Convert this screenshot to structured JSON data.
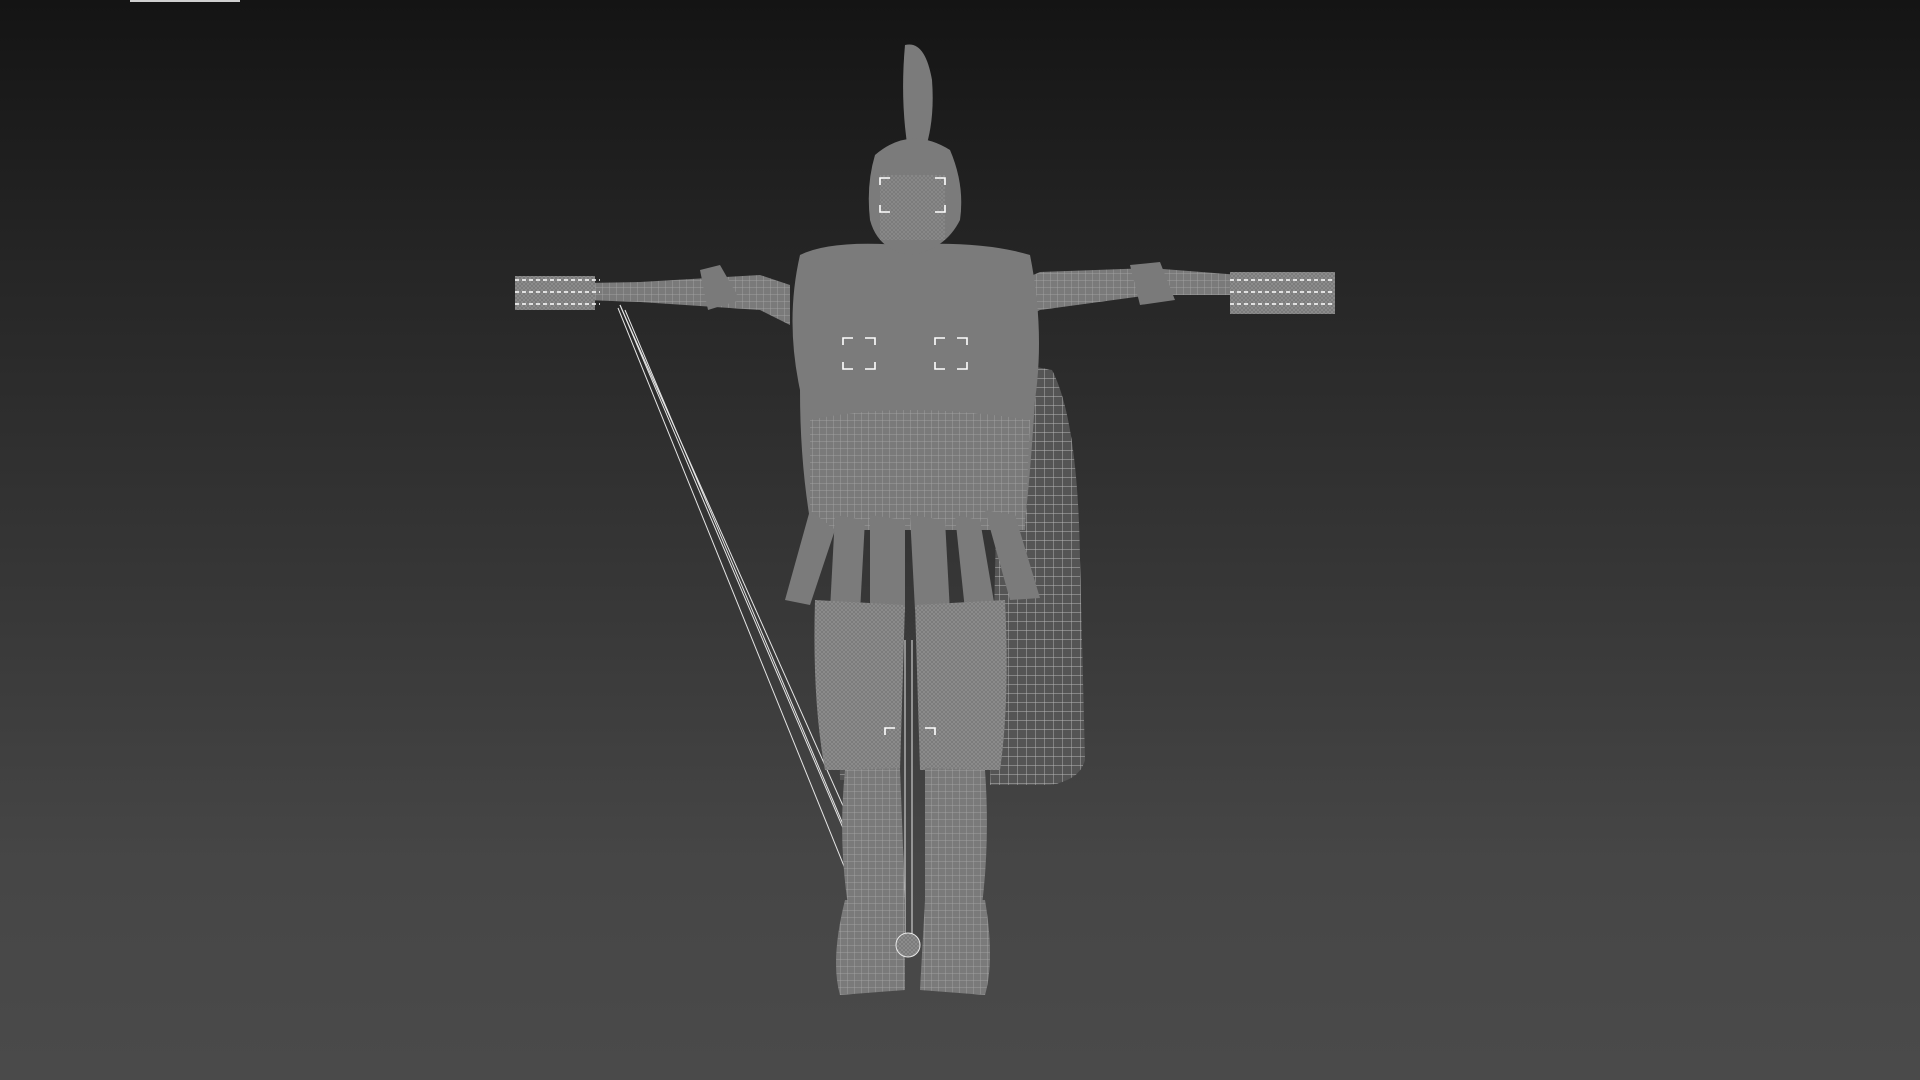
{
  "app": {
    "kind": "3d-viewport",
    "display_mode": "wireframe-over-shaded"
  },
  "viewport": {
    "background_top": "#141414",
    "background_bottom": "#4a4a4a",
    "mesh_fill": "#7b7b7b",
    "wire_color": "#bdbdbd",
    "selection_color": "#ffffff",
    "label_bar_color": "#cfcfcf"
  },
  "model": {
    "subject": "armored-warrior-tpose",
    "icons": [
      "helmet-crest",
      "cape",
      "chest-armor",
      "skirt-flaps",
      "greaves",
      "boots",
      "ik-lines"
    ]
  }
}
